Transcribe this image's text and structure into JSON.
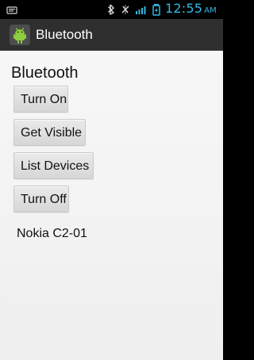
{
  "status_bar": {
    "time": "12:55",
    "ampm": "AM"
  },
  "action_bar": {
    "app_title": "Bluetooth"
  },
  "content": {
    "title": "Bluetooth",
    "buttons": {
      "turn_on": "Turn On",
      "get_visible": "Get Visible",
      "list_devices": "List Devices",
      "turn_off": "Turn Off"
    },
    "devices": [
      "Nokia C2-01"
    ]
  },
  "colors": {
    "status_accent": "#35b7e5",
    "action_bar_bg": "#2f2f2f",
    "content_bg": "#f4f4f4"
  }
}
